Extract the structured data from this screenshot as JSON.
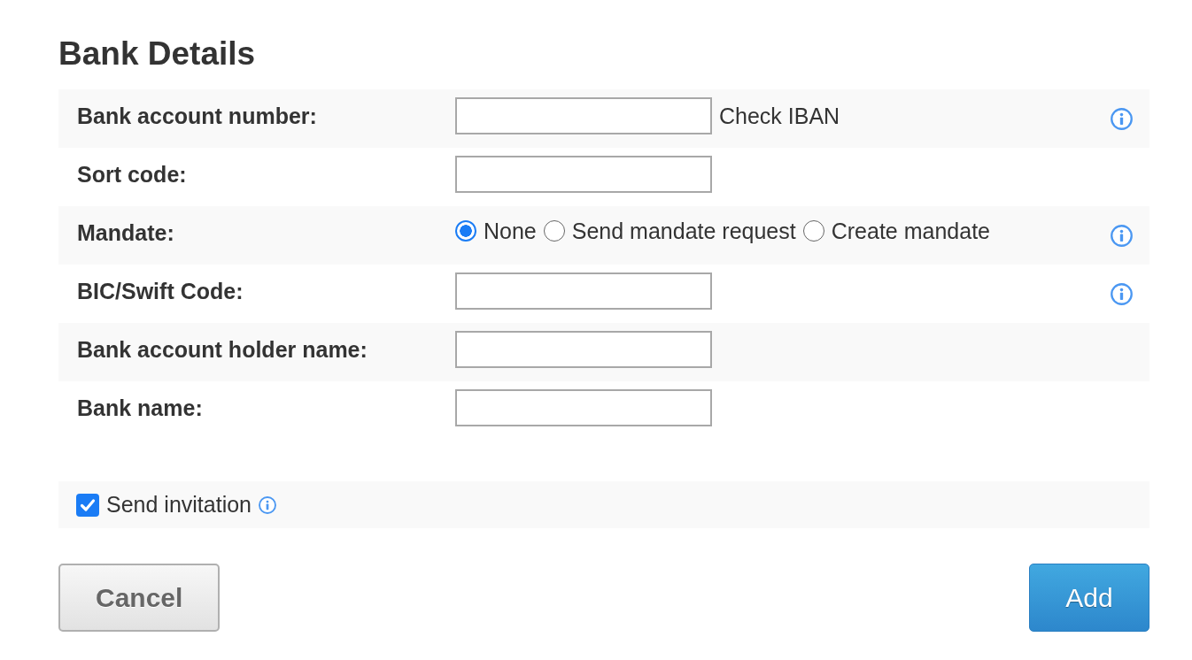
{
  "title": "Bank Details",
  "fields": [
    {
      "kind": "text",
      "label": "Bank account number:",
      "link": "Check IBAN",
      "info": true
    },
    {
      "kind": "text",
      "label": "Sort code:",
      "info": false
    },
    {
      "kind": "radio",
      "label": "Mandate:",
      "options": [
        {
          "label": "None",
          "selected": true
        },
        {
          "label": "Send mandate request",
          "selected": false
        },
        {
          "label": "Create mandate",
          "selected": false
        }
      ],
      "info": true
    },
    {
      "kind": "text",
      "label": "BIC/Swift Code:",
      "info": true
    },
    {
      "kind": "text",
      "label": "Bank account holder name:",
      "info": false
    },
    {
      "kind": "text",
      "label": "Bank name:",
      "info": false
    }
  ],
  "invitation": {
    "label": "Send invitation",
    "checked": true,
    "info": true
  },
  "buttons": [
    {
      "label": "Cancel",
      "kind": "secondary"
    },
    {
      "label": "Add",
      "kind": "primary"
    }
  ]
}
